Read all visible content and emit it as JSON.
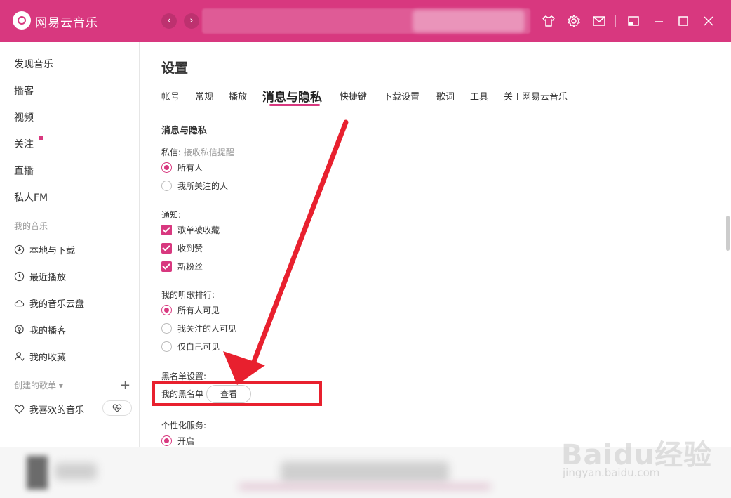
{
  "app": {
    "title": "网易云音乐"
  },
  "sidebar": {
    "items": [
      {
        "label": "发现音乐"
      },
      {
        "label": "播客"
      },
      {
        "label": "视频"
      },
      {
        "label": "关注"
      },
      {
        "label": "直播"
      },
      {
        "label": "私人FM"
      }
    ],
    "my_music_title": "我的音乐",
    "my_music": [
      {
        "label": "本地与下载",
        "icon": "download-icon"
      },
      {
        "label": "最近播放",
        "icon": "clock-icon"
      },
      {
        "label": "我的音乐云盘",
        "icon": "cloud-icon"
      },
      {
        "label": "我的播客",
        "icon": "podcast-icon"
      },
      {
        "label": "我的收藏",
        "icon": "user-icon"
      }
    ],
    "playlists_title": "创建的歌单",
    "liked_playlist": "我喜欢的音乐"
  },
  "settings": {
    "title": "设置",
    "tabs": [
      {
        "label": "帐号"
      },
      {
        "label": "常规"
      },
      {
        "label": "播放"
      },
      {
        "label": "消息与隐私"
      },
      {
        "label": "快捷键"
      },
      {
        "label": "下载设置"
      },
      {
        "label": "歌词"
      },
      {
        "label": "工具"
      },
      {
        "label": "关于网易云音乐"
      }
    ],
    "active_tab": "消息与隐私",
    "section_title": "消息与隐私",
    "dm": {
      "label": "私信:",
      "hint": "接收私信提醒",
      "options": [
        "所有人",
        "我所关注的人"
      ],
      "selected": "所有人"
    },
    "notify": {
      "label": "通知:",
      "options": [
        "歌单被收藏",
        "收到赞",
        "新粉丝"
      ],
      "checked": [
        "歌单被收藏",
        "收到赞",
        "新粉丝"
      ]
    },
    "ranking": {
      "label": "我的听歌排行:",
      "options": [
        "所有人可见",
        "我关注的人可见",
        "仅自己可见"
      ],
      "selected": "所有人可见"
    },
    "blacklist": {
      "label": "黑名单设置:",
      "item_label": "我的黑名单",
      "button": "查看"
    },
    "personal": {
      "label": "个性化服务:",
      "options": [
        "开启"
      ],
      "selected": "开启"
    }
  },
  "watermark": {
    "brand": "Baidu经验",
    "url": "jingyan.baidu.com"
  },
  "colors": {
    "accent": "#d8387f",
    "highlight": "#e8202e"
  }
}
